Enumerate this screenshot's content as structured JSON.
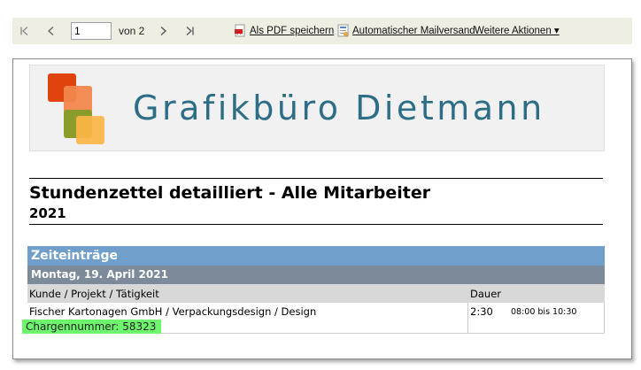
{
  "toolbar": {
    "page_value": "1",
    "page_of": "von 2",
    "pdf_label": "Als PDF speichern",
    "mail_label": "Automatischer Mailversand",
    "more_label": "Weitere Aktionen ▾",
    "icons": [
      "first-page-icon",
      "previous-page-icon",
      "next-page-icon",
      "last-page-icon",
      "pdf-icon",
      "mail-icon"
    ]
  },
  "logo": {
    "text": "Grafikbüro Dietmann",
    "colors": [
      "#e1430f",
      "#f2874c",
      "#8c9c2a",
      "#fcb646"
    ]
  },
  "report": {
    "title": "Stundenzettel detailliert - Alle Mitarbeiter",
    "year": "2021",
    "section_title": "Zeiteinträge",
    "day_title": "Montag, 19. April 2021",
    "columns": [
      "Kunde / Projekt / Tätigkeit",
      "Dauer"
    ],
    "rows": [
      {
        "description": "Fischer Kartonagen GmbH / Verpackungsdesign / Design",
        "duration": "2:30",
        "timespan": "08:00 bis 10:30",
        "batch": "Chargennummer: 58323"
      }
    ]
  },
  "colors": {
    "section_header": "#6f9fca",
    "day_header": "#7d8a9a",
    "column_header": "#d8d8d8",
    "highlight": "#6df56d",
    "logo_text": "#2d6e86",
    "toolbar_bg": "#efeee3"
  }
}
